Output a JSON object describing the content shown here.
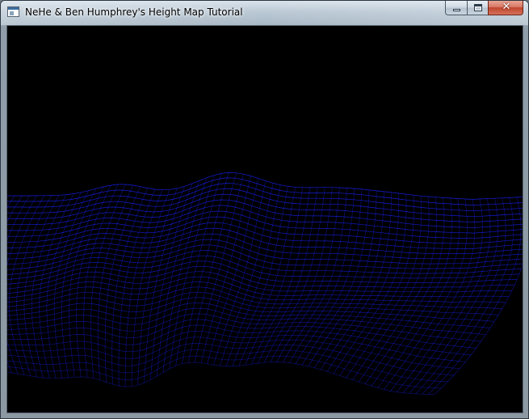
{
  "window": {
    "title": "NeHe & Ben Humphrey's Height Map Tutorial",
    "icon": "application-window-icon",
    "caption_buttons": {
      "minimize_icon": "minimize-icon",
      "maximize_icon": "maximize-icon",
      "close_icon": "close-icon",
      "close_glyph": "✕"
    }
  },
  "viewport": {
    "content": "wireframe height map terrain",
    "background_color": "#000000",
    "wire_color": "#1a22ff"
  }
}
